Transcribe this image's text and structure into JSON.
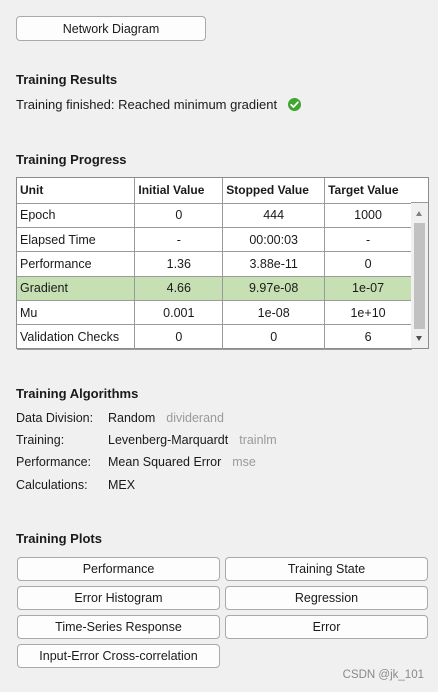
{
  "top_button": {
    "label": "Network Diagram"
  },
  "results": {
    "title": "Training Results",
    "status": "Training finished: Reached minimum gradient"
  },
  "progress": {
    "title": "Training Progress",
    "columns": [
      "Unit",
      "Initial Value",
      "Stopped Value",
      "Target Value"
    ],
    "rows": [
      {
        "unit": "Epoch",
        "initial": "0",
        "stopped": "444",
        "target": "1000",
        "highlight": false
      },
      {
        "unit": "Elapsed Time",
        "initial": "-",
        "stopped": "00:00:03",
        "target": "-",
        "highlight": false
      },
      {
        "unit": "Performance",
        "initial": "1.36",
        "stopped": "3.88e-11",
        "target": "0",
        "highlight": false
      },
      {
        "unit": "Gradient",
        "initial": "4.66",
        "stopped": "9.97e-08",
        "target": "1e-07",
        "highlight": true
      },
      {
        "unit": "Mu",
        "initial": "0.001",
        "stopped": "1e-08",
        "target": "1e+10",
        "highlight": false
      },
      {
        "unit": "Validation Checks",
        "initial": "0",
        "stopped": "0",
        "target": "6",
        "highlight": false
      }
    ],
    "highlight_color": "#c6e0b4"
  },
  "algorithms": {
    "title": "Training Algorithms",
    "rows": [
      {
        "label": "Data Division:",
        "value": "Random",
        "code": "dividerand"
      },
      {
        "label": "Training:",
        "value": "Levenberg-Marquardt",
        "code": "trainlm"
      },
      {
        "label": "Performance:",
        "value": "Mean Squared Error",
        "code": "mse"
      },
      {
        "label": "Calculations:",
        "value": "MEX",
        "code": ""
      }
    ]
  },
  "plots": {
    "title": "Training Plots",
    "buttons": {
      "performance": "Performance",
      "training_state": "Training State",
      "error_histogram": "Error Histogram",
      "regression": "Regression",
      "time_series_response": "Time-Series Response",
      "error": "Error",
      "input_error_xcorr": "Input-Error Cross-correlation"
    }
  },
  "watermark": "CSDN @jk_101",
  "colors": {
    "success": "#3ea52f",
    "background": "#f0f0f0"
  }
}
